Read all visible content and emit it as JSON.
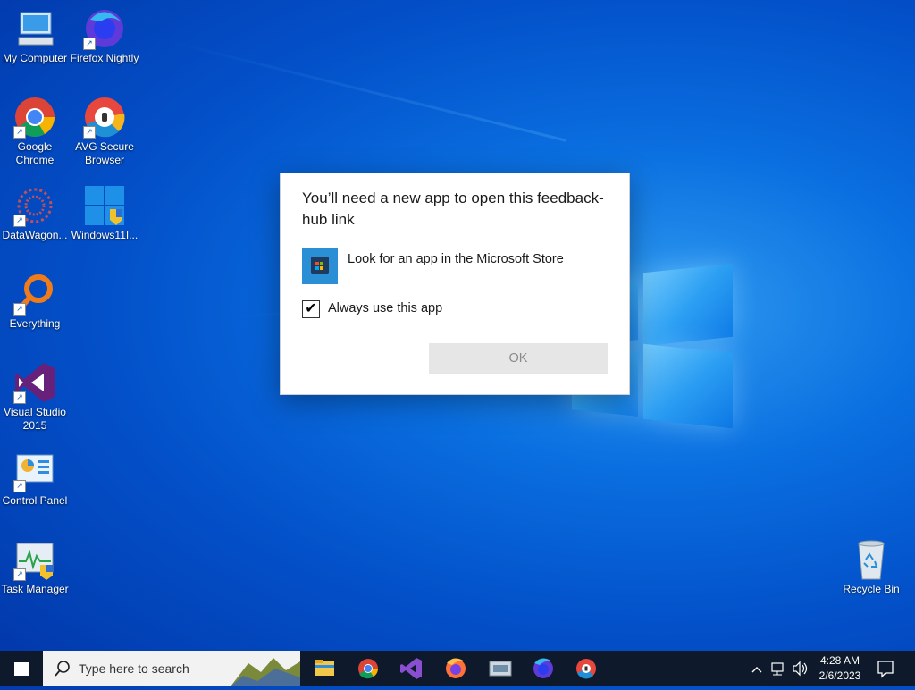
{
  "desktop": {
    "icons": [
      {
        "label": "My Computer"
      },
      {
        "label": "Firefox Nightly"
      },
      {
        "label": "Google Chrome"
      },
      {
        "label": "AVG Secure Browser"
      },
      {
        "label": "DataWagon..."
      },
      {
        "label": "Windows11I..."
      },
      {
        "label": "Everything"
      },
      {
        "label": "Visual Studio 2015"
      },
      {
        "label": "Control Panel"
      },
      {
        "label": "Task Manager"
      },
      {
        "label": "Recycle Bin"
      }
    ]
  },
  "dialog": {
    "title": "You’ll need a new app to open this feedback-hub link",
    "store_option": "Look for an app in the Microsoft Store",
    "always_use_label": "Always use this app",
    "always_use_checked": true,
    "ok_label": "OK"
  },
  "taskbar": {
    "search_placeholder": "Type here to search",
    "apps": [
      "file-explorer",
      "chrome",
      "visual-studio",
      "firefox",
      "network-app",
      "firefox-nightly",
      "avg-browser"
    ],
    "time": "4:28 AM",
    "date": "2/6/2023"
  },
  "colors": {
    "taskbar_bg": "#0e1a2b",
    "store_tile": "#2b8fd6"
  }
}
